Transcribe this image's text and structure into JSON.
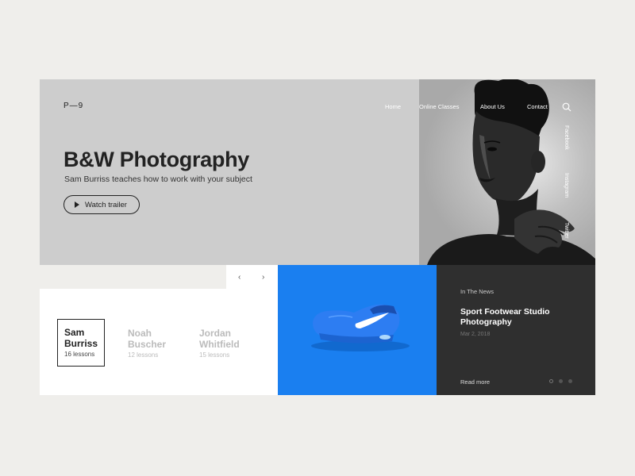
{
  "logo": "P—9",
  "nav": [
    {
      "label": "Home"
    },
    {
      "label": "Online Classes"
    },
    {
      "label": "About Us"
    },
    {
      "label": "Contact"
    }
  ],
  "social": [
    "Facebook",
    "Instagram",
    "Twitter"
  ],
  "hero": {
    "title": "B&W Photography",
    "subtitle": "Sam Burriss teaches how to work with your subject",
    "cta_label": "Watch trailer"
  },
  "slider": {
    "prev": "‹",
    "next": "›"
  },
  "teachers": [
    {
      "first": "Sam",
      "last": "Burriss",
      "lessons": "16 lessons"
    },
    {
      "first": "Noah",
      "last": "Buscher",
      "lessons": "12 lessons"
    },
    {
      "first": "Jordan",
      "last": "Whitfield",
      "lessons": "15 lessons"
    }
  ],
  "news": {
    "category": "In The News",
    "title": "Sport Footwear Studio Photography",
    "date": "Mar 2, 2018",
    "read_more": "Read more",
    "dots": 3,
    "active_dot": 0
  },
  "colors": {
    "background": "#efeeeb",
    "hero": "#cdcdcd",
    "accent_blue": "#1a7ff0",
    "dark_panel": "#2f2f2f"
  }
}
